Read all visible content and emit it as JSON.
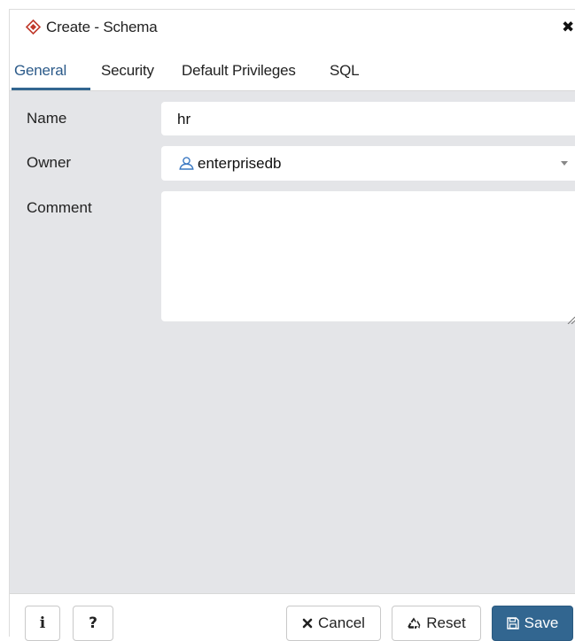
{
  "dialog": {
    "title": "Create - Schema",
    "close_glyph": "✖"
  },
  "tabs": [
    {
      "label": "General",
      "active": true
    },
    {
      "label": "Security",
      "active": false
    },
    {
      "label": "Default Privileges",
      "active": false
    },
    {
      "label": "SQL",
      "active": false
    }
  ],
  "form": {
    "name": {
      "label": "Name",
      "value": "hr"
    },
    "owner": {
      "label": "Owner",
      "value": "enterprisedb",
      "icon": "user-icon"
    },
    "comment": {
      "label": "Comment",
      "value": ""
    }
  },
  "footer": {
    "info_label": "i",
    "help_label": "?",
    "cancel_label": "Cancel",
    "reset_label": "Reset",
    "save_label": "Save"
  },
  "colors": {
    "accent": "#326690",
    "body_bg": "#e4e5e8",
    "title_icon": "#c0392b"
  }
}
